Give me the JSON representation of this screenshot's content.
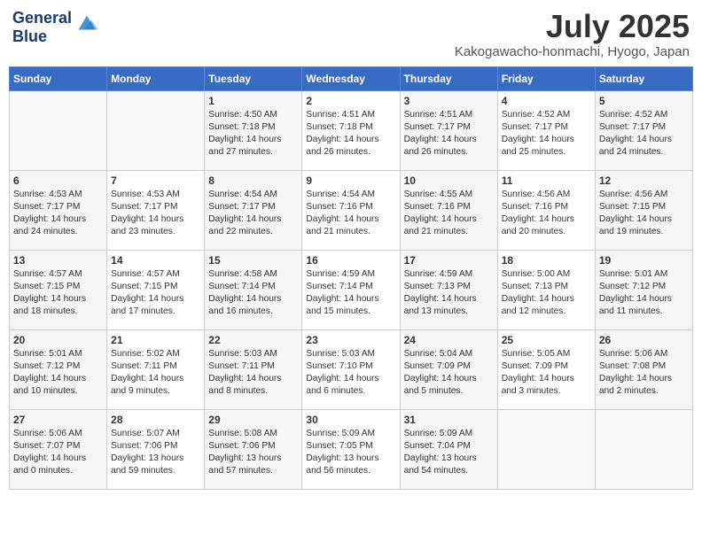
{
  "header": {
    "logo_line1": "General",
    "logo_line2": "Blue",
    "month": "July 2025",
    "location": "Kakogawacho-honmachi, Hyogo, Japan"
  },
  "weekdays": [
    "Sunday",
    "Monday",
    "Tuesday",
    "Wednesday",
    "Thursday",
    "Friday",
    "Saturday"
  ],
  "weeks": [
    [
      {
        "day": "",
        "content": ""
      },
      {
        "day": "",
        "content": ""
      },
      {
        "day": "1",
        "content": "Sunrise: 4:50 AM\nSunset: 7:18 PM\nDaylight: 14 hours and 27 minutes."
      },
      {
        "day": "2",
        "content": "Sunrise: 4:51 AM\nSunset: 7:18 PM\nDaylight: 14 hours and 26 minutes."
      },
      {
        "day": "3",
        "content": "Sunrise: 4:51 AM\nSunset: 7:17 PM\nDaylight: 14 hours and 26 minutes."
      },
      {
        "day": "4",
        "content": "Sunrise: 4:52 AM\nSunset: 7:17 PM\nDaylight: 14 hours and 25 minutes."
      },
      {
        "day": "5",
        "content": "Sunrise: 4:52 AM\nSunset: 7:17 PM\nDaylight: 14 hours and 24 minutes."
      }
    ],
    [
      {
        "day": "6",
        "content": "Sunrise: 4:53 AM\nSunset: 7:17 PM\nDaylight: 14 hours and 24 minutes."
      },
      {
        "day": "7",
        "content": "Sunrise: 4:53 AM\nSunset: 7:17 PM\nDaylight: 14 hours and 23 minutes."
      },
      {
        "day": "8",
        "content": "Sunrise: 4:54 AM\nSunset: 7:17 PM\nDaylight: 14 hours and 22 minutes."
      },
      {
        "day": "9",
        "content": "Sunrise: 4:54 AM\nSunset: 7:16 PM\nDaylight: 14 hours and 21 minutes."
      },
      {
        "day": "10",
        "content": "Sunrise: 4:55 AM\nSunset: 7:16 PM\nDaylight: 14 hours and 21 minutes."
      },
      {
        "day": "11",
        "content": "Sunrise: 4:56 AM\nSunset: 7:16 PM\nDaylight: 14 hours and 20 minutes."
      },
      {
        "day": "12",
        "content": "Sunrise: 4:56 AM\nSunset: 7:15 PM\nDaylight: 14 hours and 19 minutes."
      }
    ],
    [
      {
        "day": "13",
        "content": "Sunrise: 4:57 AM\nSunset: 7:15 PM\nDaylight: 14 hours and 18 minutes."
      },
      {
        "day": "14",
        "content": "Sunrise: 4:57 AM\nSunset: 7:15 PM\nDaylight: 14 hours and 17 minutes."
      },
      {
        "day": "15",
        "content": "Sunrise: 4:58 AM\nSunset: 7:14 PM\nDaylight: 14 hours and 16 minutes."
      },
      {
        "day": "16",
        "content": "Sunrise: 4:59 AM\nSunset: 7:14 PM\nDaylight: 14 hours and 15 minutes."
      },
      {
        "day": "17",
        "content": "Sunrise: 4:59 AM\nSunset: 7:13 PM\nDaylight: 14 hours and 13 minutes."
      },
      {
        "day": "18",
        "content": "Sunrise: 5:00 AM\nSunset: 7:13 PM\nDaylight: 14 hours and 12 minutes."
      },
      {
        "day": "19",
        "content": "Sunrise: 5:01 AM\nSunset: 7:12 PM\nDaylight: 14 hours and 11 minutes."
      }
    ],
    [
      {
        "day": "20",
        "content": "Sunrise: 5:01 AM\nSunset: 7:12 PM\nDaylight: 14 hours and 10 minutes."
      },
      {
        "day": "21",
        "content": "Sunrise: 5:02 AM\nSunset: 7:11 PM\nDaylight: 14 hours and 9 minutes."
      },
      {
        "day": "22",
        "content": "Sunrise: 5:03 AM\nSunset: 7:11 PM\nDaylight: 14 hours and 8 minutes."
      },
      {
        "day": "23",
        "content": "Sunrise: 5:03 AM\nSunset: 7:10 PM\nDaylight: 14 hours and 6 minutes."
      },
      {
        "day": "24",
        "content": "Sunrise: 5:04 AM\nSunset: 7:09 PM\nDaylight: 14 hours and 5 minutes."
      },
      {
        "day": "25",
        "content": "Sunrise: 5:05 AM\nSunset: 7:09 PM\nDaylight: 14 hours and 3 minutes."
      },
      {
        "day": "26",
        "content": "Sunrise: 5:06 AM\nSunset: 7:08 PM\nDaylight: 14 hours and 2 minutes."
      }
    ],
    [
      {
        "day": "27",
        "content": "Sunrise: 5:06 AM\nSunset: 7:07 PM\nDaylight: 14 hours and 0 minutes."
      },
      {
        "day": "28",
        "content": "Sunrise: 5:07 AM\nSunset: 7:06 PM\nDaylight: 13 hours and 59 minutes."
      },
      {
        "day": "29",
        "content": "Sunrise: 5:08 AM\nSunset: 7:06 PM\nDaylight: 13 hours and 57 minutes."
      },
      {
        "day": "30",
        "content": "Sunrise: 5:09 AM\nSunset: 7:05 PM\nDaylight: 13 hours and 56 minutes."
      },
      {
        "day": "31",
        "content": "Sunrise: 5:09 AM\nSunset: 7:04 PM\nDaylight: 13 hours and 54 minutes."
      },
      {
        "day": "",
        "content": ""
      },
      {
        "day": "",
        "content": ""
      }
    ]
  ]
}
